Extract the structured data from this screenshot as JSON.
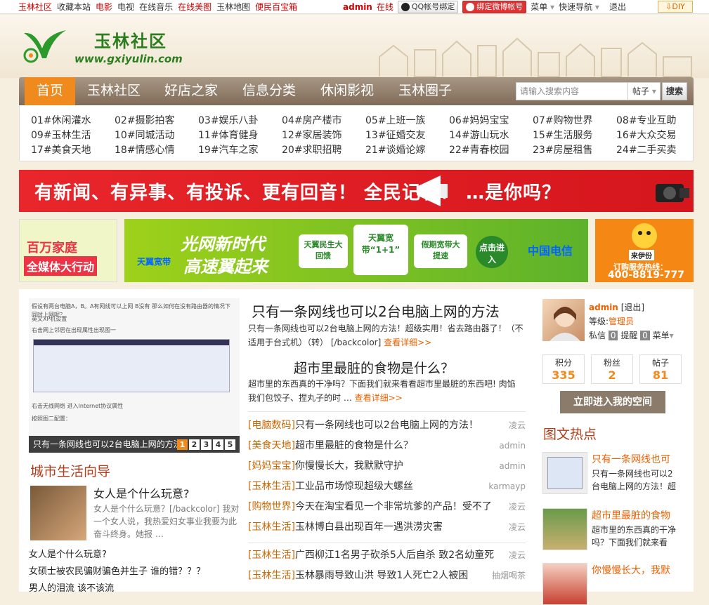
{
  "topbar": {
    "left": [
      "玉林社区",
      "收藏本站",
      "电影",
      "电视",
      "在线音乐",
      "在线美图",
      "玉林地图",
      "便民百宝箱"
    ],
    "user": "admin",
    "status": "在线",
    "qq_bind": "QQ帐号绑定",
    "weibo_bind": "绑定微博帐号",
    "menu": "菜单",
    "quicknav": "快速导航",
    "logout": "退出",
    "diy": "DIY"
  },
  "header": {
    "site_name": "玉林社区",
    "site_url": "www.gxiyulin.com"
  },
  "nav": {
    "items": [
      "首页",
      "玉林社区",
      "好店之家",
      "信息分类",
      "休闲影视",
      "玉林圈子"
    ],
    "search_placeholder": "请输入搜索内容",
    "search_scope": "帖子",
    "search_button": "搜索"
  },
  "subnav": [
    "01#休闲灌水",
    "02#摄影拍客",
    "03#娱乐八卦",
    "04#房产楼市",
    "05#上班一族",
    "06#妈妈宝宝",
    "07#购物世界",
    "08#专业互助",
    "09#玉林生活",
    "10#同城活动",
    "11#体育健身",
    "12#家居装饰",
    "13#征婚交友",
    "14#游山玩水",
    "15#生活服务",
    "16#大众交易",
    "17#美食天地",
    "18#情感心情",
    "19#汽车之家",
    "20#求职招聘",
    "21#谈婚论嫁",
    "22#青春校园",
    "23#房屋租售",
    "24#二手买卖"
  ],
  "banner": {
    "text": "有新闻、有异事、有投诉、更有回音！  全民记者！ …是你吗？",
    "left_ad": [
      "百万家庭",
      "全媒体大行动"
    ],
    "middle_ad": [
      "天翼宽带",
      "光网新时代",
      "高速翼起来",
      "天翼民生大回馈",
      "天翼宽带“1+1”",
      "假期宽带大提速",
      "点击进入",
      "中国电信"
    ],
    "right_ad": [
      "来伊份",
      "订购服务热线：",
      "400-8819-777"
    ]
  },
  "slider": {
    "caption": "只有一条网线也可以2台电脑上网的方法",
    "pages": [
      "1",
      "2",
      "3",
      "4",
      "5"
    ],
    "shot_lines": [
      "假设有两台电脑A，B。A有网线可以上网 B没有 那么如何在没有路由器的情况下同时上网呢？",
      "英文XP机设置",
      "右击网上邻居在出现属性出现图一",
      "右击无线网络 进入Internet协议属性",
      "按照图二配置："
    ]
  },
  "article1": {
    "title": "只有一条网线也可以2台电脑上网的方法",
    "summary": "只有一条网线也可以2台电脑上网的方法！超级实用！省去路由器了！（不适用于台式机）（转） [/backcolor]",
    "more": "查看详细>>"
  },
  "article2": {
    "title": "超市里最脏的食物是什么？",
    "summary": "超市里的东西真的干净吗？下面我们就来看看超市里最脏的东西吧! 肉馅　　我们包饺子、捏丸子的时 …",
    "more": "查看详细>>"
  },
  "list": [
    {
      "cat": "[电脑数码]",
      "title": "只有一条网线也可以2台电脑上网的方法！",
      "author": "凌云"
    },
    {
      "cat": "[美食天地]",
      "title": "超市里最脏的食物是什么？",
      "author": "admin"
    },
    {
      "cat": "[妈妈宝宝]",
      "title": "你慢慢长大，我默默守护",
      "author": "admin"
    },
    {
      "cat": "[玉林生活]",
      "title": "工业品市场惊现超级大螺丝",
      "author": "karmayp"
    },
    {
      "cat": "[购物世界]",
      "title": "今天在淘宝看见一个非常坑爹的产品！受不了",
      "author": "凌云"
    },
    {
      "cat": "[玉林生活]",
      "title": "玉林博白县出现百年一遇洪涝灾害",
      "author": "凌云"
    },
    {
      "cat": "[玉林生活]",
      "title": "广西柳江1名男子砍杀5人后自杀 致2名幼童死",
      "author": "凌云"
    },
    {
      "cat": "[玉林生活]",
      "title": "玉林暴雨导致山洪 导致1人死亡2人被困",
      "author": "抽烟喝茶"
    }
  ],
  "user": {
    "name": "admin",
    "logout": "[退出]",
    "level_label": "等级:",
    "level": "管理员",
    "pm": "私信",
    "pm_count": "0",
    "remind": "提醒",
    "remind_count": "0",
    "menu": "菜单",
    "stats": [
      {
        "label": "积分",
        "value": "335"
      },
      {
        "label": "粉丝",
        "value": "2"
      },
      {
        "label": "帖子",
        "value": "81"
      }
    ],
    "enter": "立即进入我的空间"
  },
  "hot": {
    "title": "图文热点",
    "items": [
      {
        "title": "只有一条网线也可",
        "desc": "只有一条网线也可以2台电脑上网的方法！超"
      },
      {
        "title": "超市里最脏的食物",
        "desc": "超市里的东西真的干净吗？下面我们就来看"
      },
      {
        "title": "你慢慢长大，我默",
        "desc": ""
      }
    ]
  },
  "city": {
    "title": "城市生活向导",
    "item_title": "女人是个什么玩意?",
    "item_desc": "女人是个什么玩意？[/backcolor] 我对一个女人说，我热爱妇女事业我要为此奋斗终身。她报 …",
    "lines": [
      "女人是个什么玩意?",
      "女硕士被农民骗财骗色并生子 谁的错？？？",
      "男人的泪流 该不该流"
    ]
  },
  "colors": {
    "accent": "#f08a1c",
    "nav": "#8f7c69",
    "link_orange": "#f06000",
    "green": "#2b7d1e",
    "red": "#c00"
  }
}
